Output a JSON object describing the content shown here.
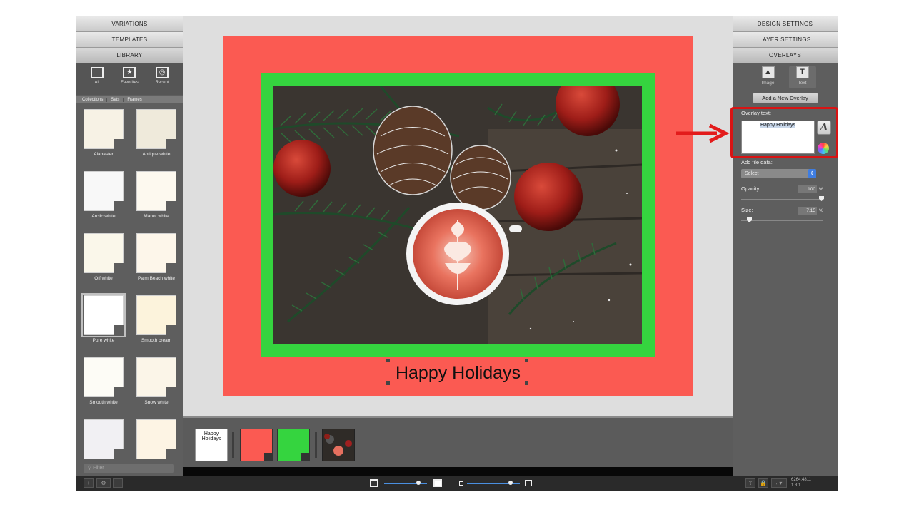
{
  "left_panel": {
    "headers": [
      "VARIATIONS",
      "TEMPLATES",
      "LIBRARY"
    ],
    "library_tabs": [
      {
        "label": "All",
        "icon": "square-outline-icon"
      },
      {
        "label": "Favorites",
        "icon": "star-icon"
      },
      {
        "label": "Recent",
        "icon": "clock-icon"
      }
    ],
    "breadcrumb": [
      "Collections",
      "Sets",
      "Frames"
    ],
    "frames": [
      {
        "name": "Alabaster",
        "color": "#f7f2e5"
      },
      {
        "name": "Antique white",
        "color": "#efeadb"
      },
      {
        "name": "Arctic white",
        "color": "#f8f8f8"
      },
      {
        "name": "Manor white",
        "color": "#fdf9ef"
      },
      {
        "name": "Off white",
        "color": "#faf7ea"
      },
      {
        "name": "Palm Beach white",
        "color": "#fdf6ea"
      },
      {
        "name": "Pure white",
        "color": "#ffffff"
      },
      {
        "name": "Smooth cream",
        "color": "#fcf3dc"
      },
      {
        "name": "Smooth white",
        "color": "#fdfcf6"
      },
      {
        "name": "Snow white",
        "color": "#fbf5e8"
      },
      {
        "name": "",
        "color": "#f1f0f3"
      },
      {
        "name": "",
        "color": "#fdf4e4"
      }
    ],
    "selected_frame": "Pure white",
    "filter_placeholder": "Filter"
  },
  "canvas": {
    "overlay_text": "Happy Holidays",
    "outer_mat_color": "#fb5a52",
    "inner_mat_color": "#35d43f"
  },
  "layers": {
    "text_layer_label": "Happy\nHolidays",
    "colors": [
      "#fb5a52",
      "#35d43f"
    ]
  },
  "right_panel": {
    "headers": [
      "DESIGN SETTINGS",
      "LAYER SETTINGS",
      "OVERLAYS"
    ],
    "overlay_tabs": [
      {
        "label": "Image",
        "icon": "image-icon"
      },
      {
        "label": "Text",
        "icon": "text-icon"
      }
    ],
    "add_overlay_button": "Add a New Overlay",
    "overlay_text_label": "Overlay text:",
    "overlay_text_value": "Happy Holidays",
    "add_file_data_label": "Add file data:",
    "select_value": "Select",
    "opacity_label": "Opacity:",
    "opacity_value": "100",
    "opacity_unit": "%",
    "size_label": "Size:",
    "size_value": "7.15",
    "size_unit": "%"
  },
  "bottom_bar": {
    "dimensions": "6264:4811",
    "ratio": "1.3:1",
    "thumb_zoom_level": 0.8,
    "preview_zoom_level": 0.82
  },
  "annotation": {
    "arrow_color": "#e31b1b"
  }
}
